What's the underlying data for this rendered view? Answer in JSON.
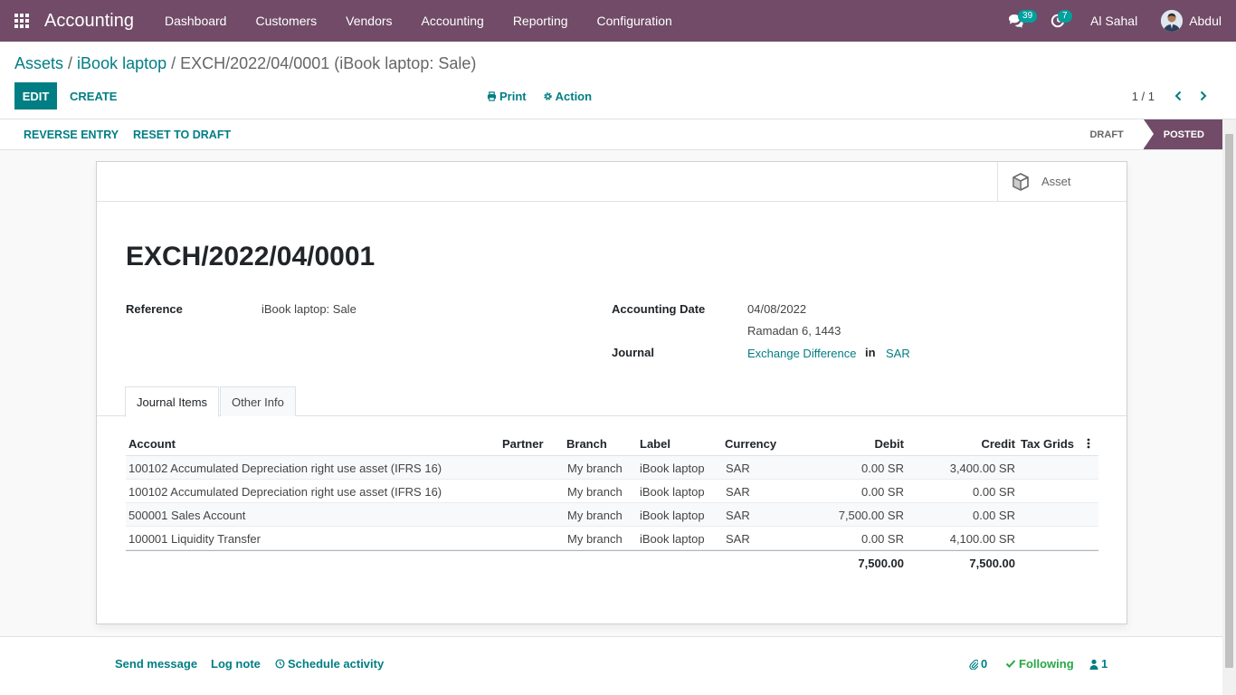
{
  "navbar": {
    "brand": "Accounting",
    "menu": [
      "Dashboard",
      "Customers",
      "Vendors",
      "Accounting",
      "Reporting",
      "Configuration"
    ],
    "messages_count": "39",
    "activities_count": "7",
    "company": "Al Sahal",
    "user": "Abdul"
  },
  "breadcrumb": {
    "item1": "Assets",
    "item2": "iBook laptop",
    "current": "EXCH/2022/04/0001 (iBook laptop: Sale)"
  },
  "control": {
    "edit": "EDIT",
    "create": "CREATE",
    "print": "Print",
    "action": "Action",
    "pager": "1 / 1"
  },
  "statusbar": {
    "reverse": "REVERSE ENTRY",
    "reset": "RESET TO DRAFT",
    "state_draft": "DRAFT",
    "state_posted": "POSTED"
  },
  "sheet": {
    "smart_button": "Asset",
    "title": "EXCH/2022/04/0001",
    "reference_label": "Reference",
    "reference_value": "iBook laptop: Sale",
    "date_label": "Accounting Date",
    "date_value": "04/08/2022",
    "date_hijri": "Ramadan 6, 1443",
    "journal_label": "Journal",
    "journal_value": "Exchange Difference",
    "journal_in": "in",
    "journal_currency": "SAR",
    "tabs": [
      "Journal Items",
      "Other Info"
    ]
  },
  "table": {
    "headers": [
      "Account",
      "Partner",
      "Branch",
      "Label",
      "Currency",
      "Debit",
      "Credit",
      "Tax Grids"
    ],
    "rows": [
      {
        "account": "100102 Accumulated Depreciation right use asset (IFRS 16)",
        "partner": "",
        "branch": "My branch",
        "label": "iBook laptop",
        "currency": "SAR",
        "debit": "0.00 SR",
        "credit": "3,400.00 SR"
      },
      {
        "account": "100102 Accumulated Depreciation right use asset (IFRS 16)",
        "partner": "",
        "branch": "My branch",
        "label": "iBook laptop",
        "currency": "SAR",
        "debit": "0.00 SR",
        "credit": "0.00 SR"
      },
      {
        "account": "500001 Sales Account",
        "partner": "",
        "branch": "My branch",
        "label": "iBook laptop",
        "currency": "SAR",
        "debit": "7,500.00 SR",
        "credit": "0.00 SR"
      },
      {
        "account": "100001 Liquidity Transfer",
        "partner": "",
        "branch": "My branch",
        "label": "iBook laptop",
        "currency": "SAR",
        "debit": "0.00 SR",
        "credit": "4,100.00 SR"
      }
    ],
    "total_debit": "7,500.00",
    "total_credit": "7,500.00"
  },
  "chatter": {
    "send_message": "Send message",
    "log_note": "Log note",
    "schedule": "Schedule activity",
    "attachments": "0",
    "following": "Following",
    "followers": "1"
  },
  "colors": {
    "brand": "#714b67",
    "accent": "#017e84",
    "badge": "#00a09d",
    "following": "#28a745"
  }
}
